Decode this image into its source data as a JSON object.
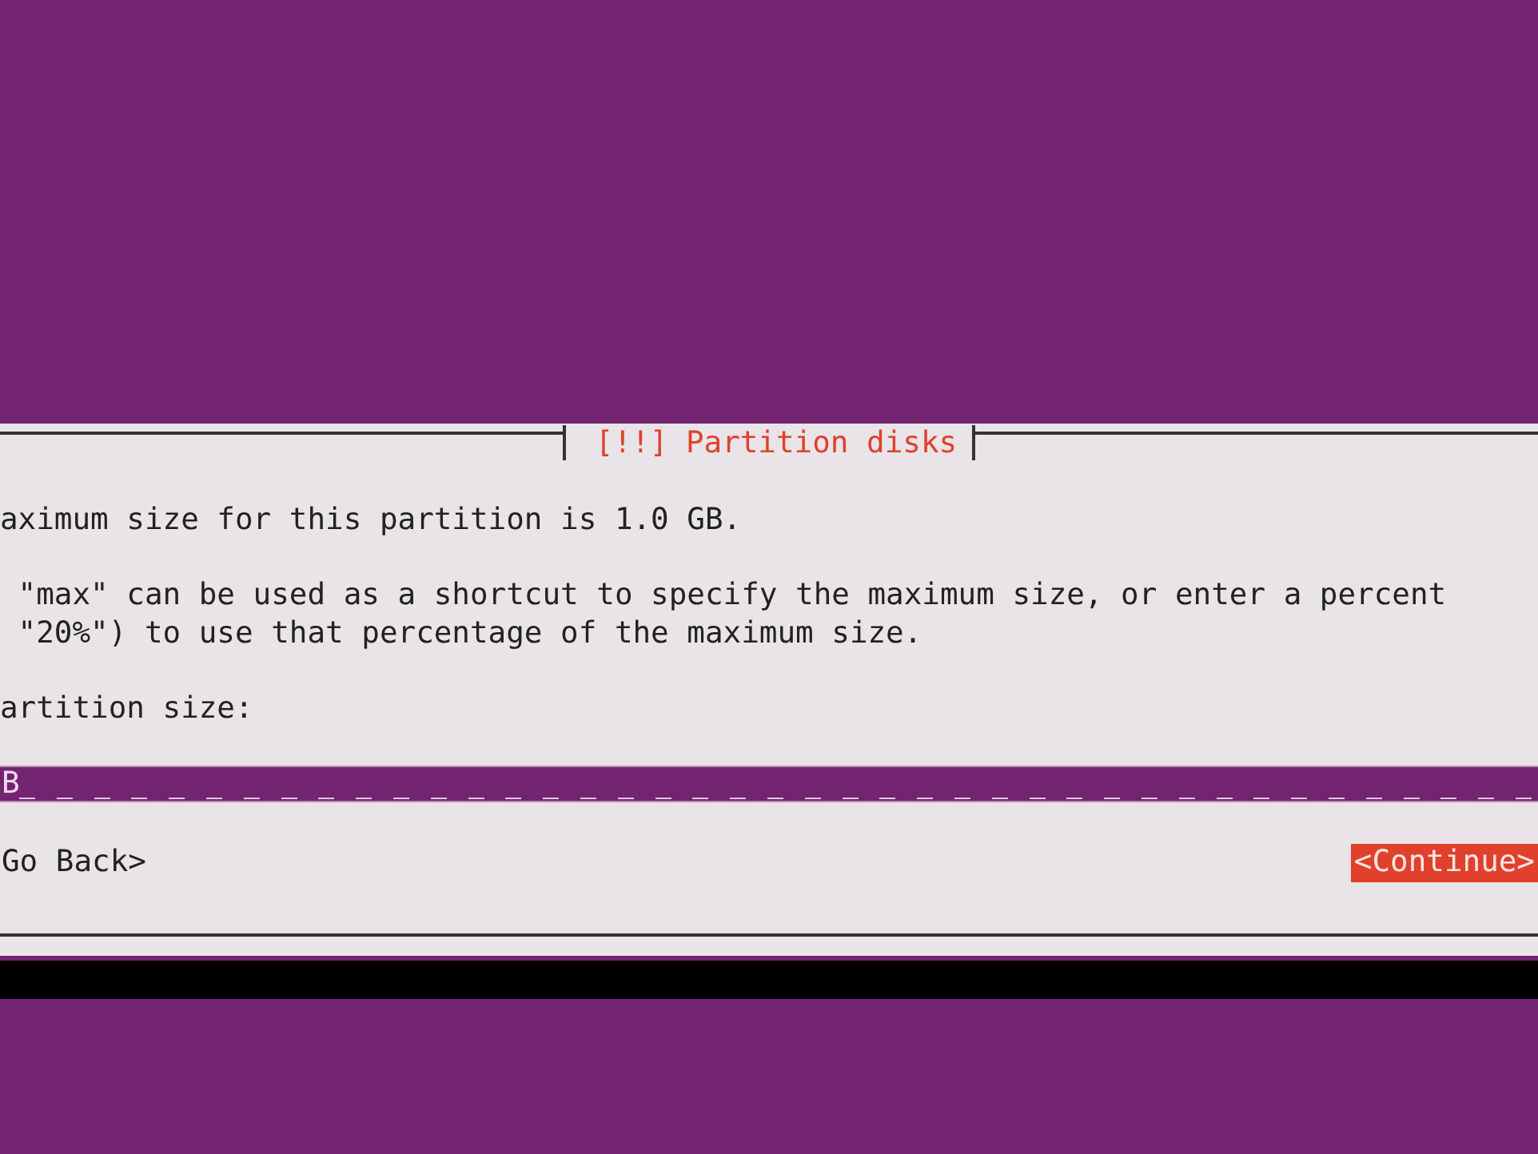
{
  "dialog": {
    "title": "[!!] Partition disks",
    "paragraphs": [
      [
        "aximum size for this partition is 1.0 GB."
      ],
      [
        " \"max\" can be used as a shortcut to specify the maximum size, or enter a percent",
        " \"20%\") to use that percentage of the maximum size."
      ],
      [
        "artition size:"
      ]
    ],
    "field": {
      "value": "B"
    },
    "buttons": [
      {
        "label": "Go Back>",
        "selected": false
      },
      {
        "label": "<Continue>",
        "selected": true
      }
    ]
  }
}
